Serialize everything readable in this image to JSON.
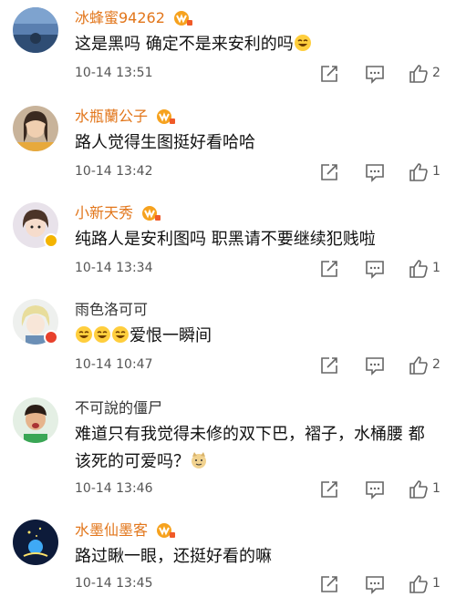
{
  "comments": [
    {
      "username": "冰蜂蜜94262",
      "vip": true,
      "text": "这是黑吗 确定不是来安利的吗",
      "emoji_after": "laugh-emoji",
      "time": "10-14 13:51",
      "likes": "2"
    },
    {
      "username": "水瓶蘭公子",
      "vip": true,
      "text": "路人觉得生图挺好看哈哈",
      "time": "10-14 13:42",
      "likes": "1"
    },
    {
      "username": "小新天秀",
      "vip": true,
      "text": "纯路人是安利图吗 职黑请不要继续犯贱啦",
      "time": "10-14 13:34",
      "likes": "1"
    },
    {
      "username": "雨色洛可可",
      "vip": false,
      "text": "爱恨一瞬间",
      "emoji_before": "laugh-emoji x3",
      "time": "10-14 10:47",
      "likes": "2"
    },
    {
      "username": "不可說的僵尸",
      "vip": false,
      "text_line1": "难道只有我觉得未修的双下巴，褶子，水桶腰 都",
      "text_line2": "该死的可爱吗？",
      "emoji_after": "doge-emoji",
      "time": "10-14 13:46",
      "likes": "1"
    },
    {
      "username": "水墨仙墨客",
      "vip": true,
      "text": "路过瞅一眼，还挺好看的嘛",
      "time": "10-14 13:45",
      "likes": "1"
    }
  ],
  "colors": {
    "vip_name": "#e2761b",
    "plain_name": "#333333",
    "icon_gray": "#666666"
  },
  "icons": {
    "share": "share-icon",
    "reply": "comment-icon",
    "like": "thumbs-up-icon"
  }
}
